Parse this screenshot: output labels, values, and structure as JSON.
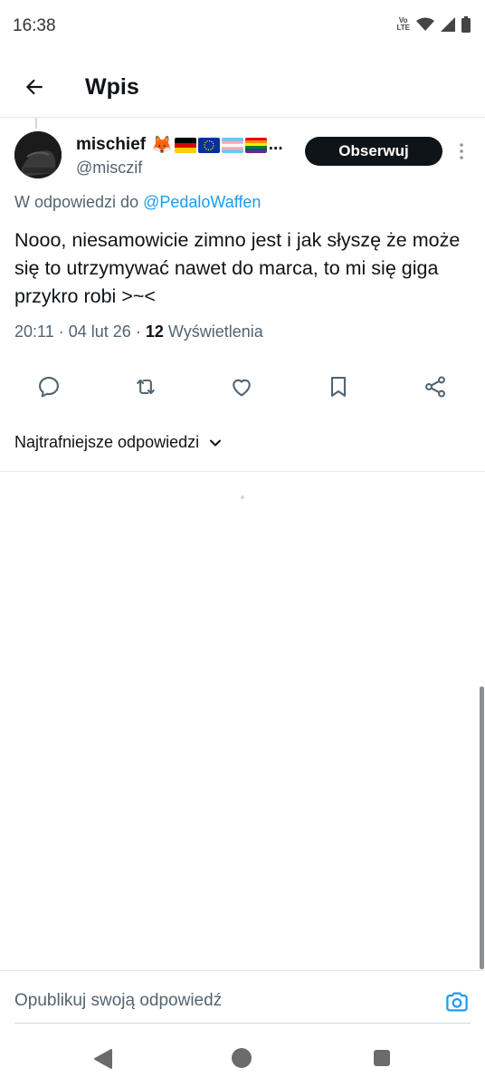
{
  "status_bar": {
    "time": "16:38",
    "volte_top": "Vo",
    "volte_bottom": "LTE"
  },
  "header": {
    "title": "Wpis"
  },
  "tweet": {
    "author": {
      "name": "mischief",
      "name_suffix": "🦊",
      "ellipsis": "...",
      "handle": "@misczif"
    },
    "follow_label": "Obserwuj",
    "reply_to_prefix": "W odpowiedzi do",
    "reply_to_mention": "@PedaloWaffen",
    "text": "Nooo, niesamowicie zimno jest i jak słyszę że może się to utrzymywać nawet do marca, to mi się giga przykro robi >~<",
    "time": "20:11",
    "separator": "·",
    "date": "04 lut 26",
    "views_count": "12",
    "views_label": "Wyświetlenia"
  },
  "sort": {
    "label": "Najtrafniejsze odpowiedzi"
  },
  "composer": {
    "placeholder": "Opublikuj swoją odpowiedź"
  },
  "colors": {
    "link": "#1d9bf0",
    "secondary": "#536471",
    "primary": "#0f1419"
  },
  "icons": [
    "back-arrow-icon",
    "more-icon",
    "reply-icon",
    "retweet-icon",
    "like-icon",
    "bookmark-icon",
    "share-icon",
    "chevron-down-icon",
    "camera-icon"
  ]
}
